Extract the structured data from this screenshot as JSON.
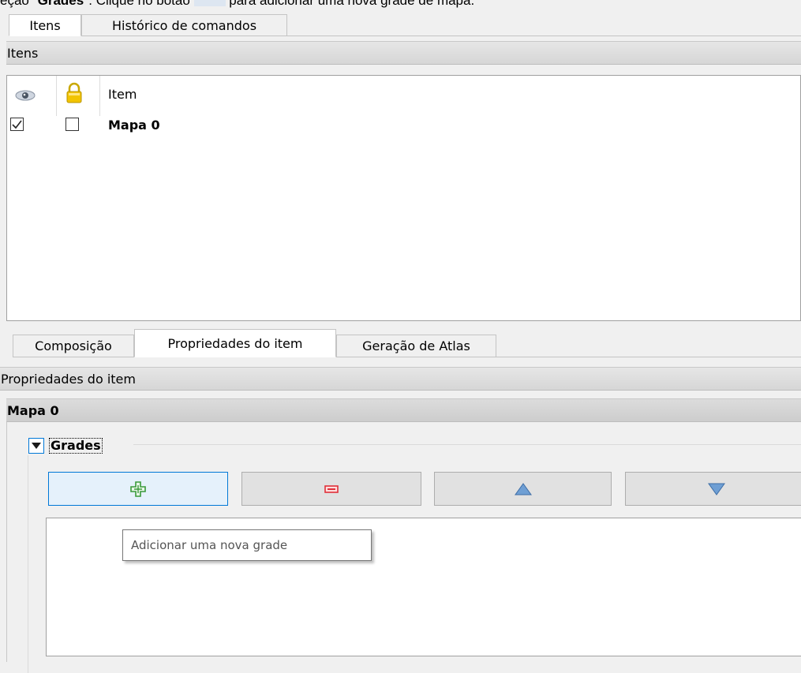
{
  "caption": {
    "prefix": "eção \"",
    "bold": "Grades",
    "middle": "\". Clique no botão",
    "suffix": "para adicionar uma nova grade de mapa."
  },
  "top_tabs": [
    "Itens",
    "Histórico de comandos"
  ],
  "items_panel": {
    "title": "Itens",
    "column_item": "Item",
    "rows": [
      {
        "name": "Mapa 0",
        "visible": true,
        "locked": false
      }
    ]
  },
  "bottom_tabs": [
    "Composição",
    "Propriedades do item",
    "Geração de Atlas"
  ],
  "properties": {
    "title": "Propriedades do item",
    "item_name": "Mapa 0",
    "group_label": "Grades",
    "tooltip": "Adicionar uma nova grade"
  },
  "colors": {
    "add": "#3a9a3a",
    "remove": "#e0303a",
    "arrow": "#5b8ec7",
    "focus": "#0078d7"
  },
  "icons": [
    "eye-icon",
    "lock-icon",
    "add-icon",
    "remove-icon",
    "move-up-icon",
    "move-down-icon",
    "collapse-triangle-icon"
  ]
}
